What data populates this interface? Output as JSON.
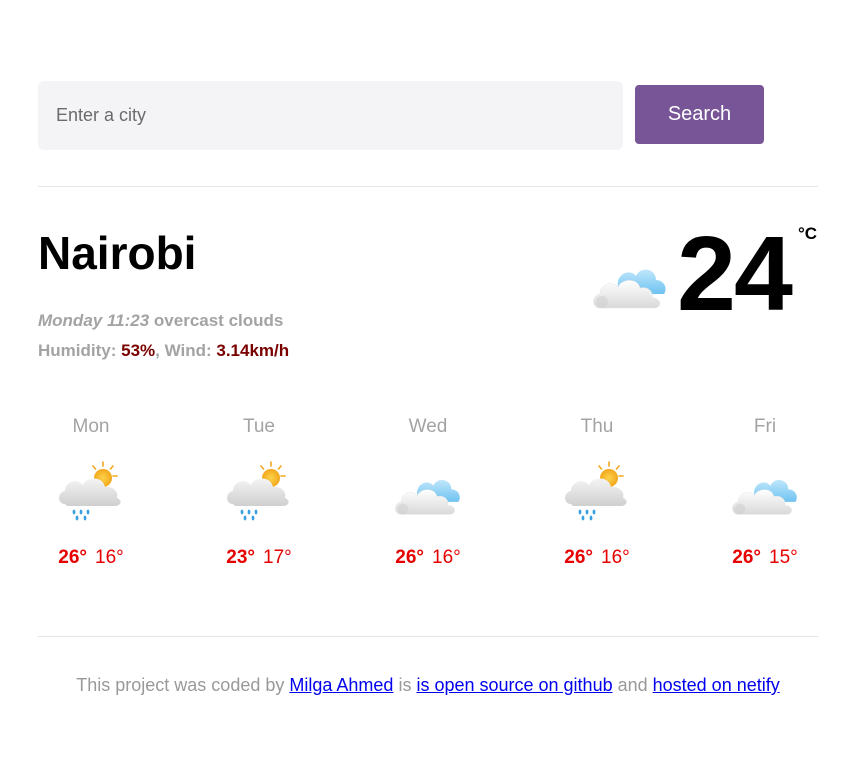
{
  "search": {
    "placeholder": "Enter a city",
    "value": "",
    "button_label": "Search",
    "button_color": "#775596"
  },
  "current": {
    "city": "Nairobi",
    "day_time": "Monday 11:23",
    "description": "overcast clouds",
    "humidity_label": "Humidity: ",
    "humidity_value": "53%",
    "wind_label": ", Wind: ",
    "wind_value": "3.14km/h",
    "temperature": "24",
    "unit": "°C",
    "icon": "overcast-clouds-icon"
  },
  "forecast": [
    {
      "day": "Mon",
      "max": "26°",
      "min": "16°",
      "icon": "rain-sun-cloud-icon"
    },
    {
      "day": "Tue",
      "max": "23°",
      "min": "17°",
      "icon": "rain-sun-cloud-icon"
    },
    {
      "day": "Wed",
      "max": "26°",
      "min": "16°",
      "icon": "overcast-clouds-icon"
    },
    {
      "day": "Thu",
      "max": "26°",
      "min": "16°",
      "icon": "rain-sun-cloud-icon"
    },
    {
      "day": "Fri",
      "max": "26°",
      "min": "15°",
      "icon": "overcast-clouds-icon"
    }
  ],
  "footer": {
    "text_1": "This project was coded by ",
    "author_link": "Milga Ahmed",
    "text_2": " is ",
    "github_link": "is open source on github",
    "text_3": " and ",
    "hosting_link": "hosted on netify"
  },
  "colors": {
    "accent": "#775596",
    "temp_red": "#e60000",
    "detail_value": "#7a0000",
    "muted": "#a3a3a3"
  }
}
